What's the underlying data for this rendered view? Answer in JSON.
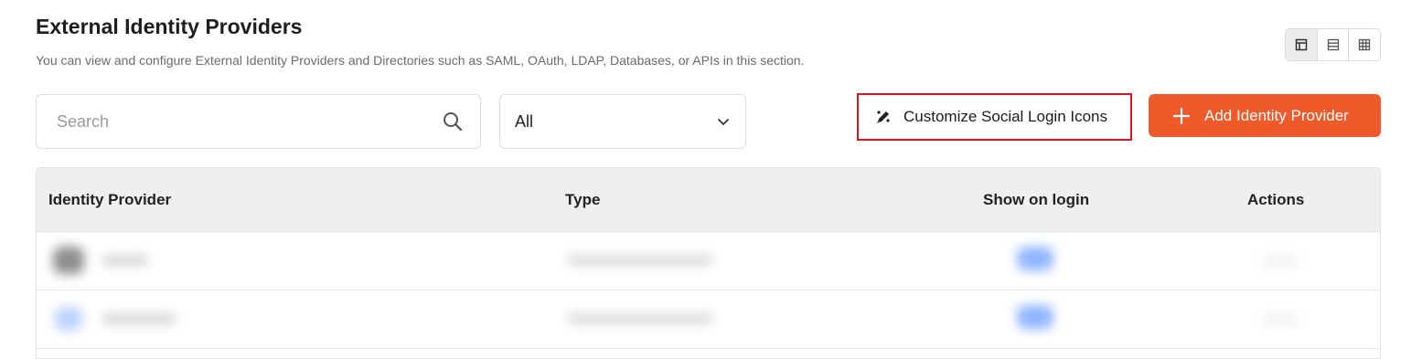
{
  "header": {
    "title": "External Identity Providers",
    "subtitle": "You can view and configure External Identity Providers and Directories such as SAML, OAuth, LDAP, Databases, or APIs in this section."
  },
  "view_toggle": {
    "options": [
      {
        "name": "card-view-icon",
        "active": true
      },
      {
        "name": "list-view-icon",
        "active": false
      },
      {
        "name": "grid-view-icon",
        "active": false
      }
    ]
  },
  "search": {
    "placeholder": "Search",
    "value": ""
  },
  "filter": {
    "selected": "All"
  },
  "buttons": {
    "customize_label": "Customize Social Login Icons",
    "add_label": "Add Identity Provider"
  },
  "table": {
    "columns": [
      "Identity Provider",
      "Type",
      "Show on login",
      "Actions"
    ]
  },
  "colors": {
    "accent": "#ee5a2a",
    "highlight_border": "#e0141c",
    "header_bg": "#efefef"
  }
}
